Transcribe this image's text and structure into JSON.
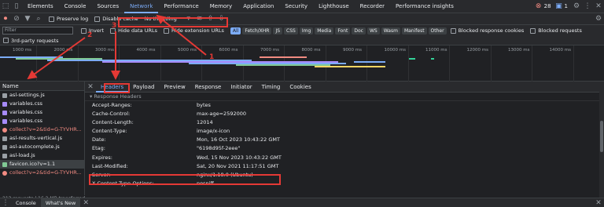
{
  "top_tabs": [
    "Elements",
    "Console",
    "Sources",
    "Network",
    "Performance",
    "Memory",
    "Application",
    "Security",
    "Lighthouse",
    "Recorder",
    "Performance insights"
  ],
  "active_tab": "Network",
  "status_counts": {
    "errors": "28",
    "warnings": "1"
  },
  "toolbar": {
    "preserve_log": "Preserve log",
    "disable_cache": "Disable cache",
    "throttling": "No throttling"
  },
  "filter": {
    "placeholder": "Filter",
    "invert": "Invert",
    "hide_data_urls": "Hide data URLs",
    "hide_extension_urls": "Hide extension URLs",
    "types": [
      "All",
      "Fetch/XHR",
      "JS",
      "CSS",
      "Img",
      "Media",
      "Font",
      "Doc",
      "WS",
      "Wasm",
      "Manifest",
      "Other"
    ],
    "blocked_response_cookies": "Blocked response cookies",
    "blocked_requests": "Blocked requests",
    "third_party": "3rd-party requests"
  },
  "timeline_ticks": [
    "1000 ms",
    "2000 ms",
    "3000 ms",
    "4000 ms",
    "5000 ms",
    "6000 ms",
    "7000 ms",
    "8000 ms",
    "9000 ms",
    "10000 ms",
    "11000 ms",
    "12000 ms",
    "13000 ms",
    "14000 ms"
  ],
  "request_list": {
    "name_header": "Name",
    "items": [
      {
        "name": "asl-settings.js",
        "kind": "js"
      },
      {
        "name": "variables.css",
        "kind": "css"
      },
      {
        "name": "variables.css",
        "kind": "css"
      },
      {
        "name": "variables.css",
        "kind": "css"
      },
      {
        "name": "collect?v=2&tid=G-TYVHR...",
        "kind": "err"
      },
      {
        "name": "asl-results-vertical.js",
        "kind": "js"
      },
      {
        "name": "asl-autocomplete.js",
        "kind": "js"
      },
      {
        "name": "asl-load.js",
        "kind": "js"
      },
      {
        "name": "favicon.ico?v=1.1",
        "kind": "img"
      },
      {
        "name": "collect?v=2&tid=G-TYVHR...",
        "kind": "err"
      }
    ],
    "summary": "213 requests  |  16.2 MB transferred"
  },
  "detail_tabs": [
    "Headers",
    "Payload",
    "Preview",
    "Response",
    "Initiator",
    "Timing",
    "Cookies"
  ],
  "active_detail_tab": "Headers",
  "response_headers_title": "▾ Response Headers",
  "headers": [
    {
      "key": "Accept-Ranges:",
      "value": "bytes"
    },
    {
      "key": "Cache-Control:",
      "value": "max-age=2592000"
    },
    {
      "key": "Content-Length:",
      "value": "12014"
    },
    {
      "key": "Content-Type:",
      "value": "image/x-icon"
    },
    {
      "key": "Date:",
      "value": "Mon, 16 Oct 2023 10:43:22 GMT"
    },
    {
      "key": "Etag:",
      "value": "\"6198d95f-2eee\""
    },
    {
      "key": "Expires:",
      "value": "Wed, 15 Nov 2023 10:43:22 GMT"
    },
    {
      "key": "Last-Modified:",
      "value": "Sat, 20 Nov 2021 11:17:51 GMT"
    },
    {
      "key": "Server:",
      "value": "nginx/1.18.0 (Ubuntu)"
    },
    {
      "key": "X-Content-Type-Options:",
      "value": "nosniff"
    }
  ],
  "drawer_tabs": [
    "Console",
    "What's New"
  ],
  "annotations": [
    "1",
    "2",
    "3"
  ],
  "colors": {
    "accent": "#7cacf8",
    "annotation": "#e53935",
    "error": "#f28b82"
  }
}
